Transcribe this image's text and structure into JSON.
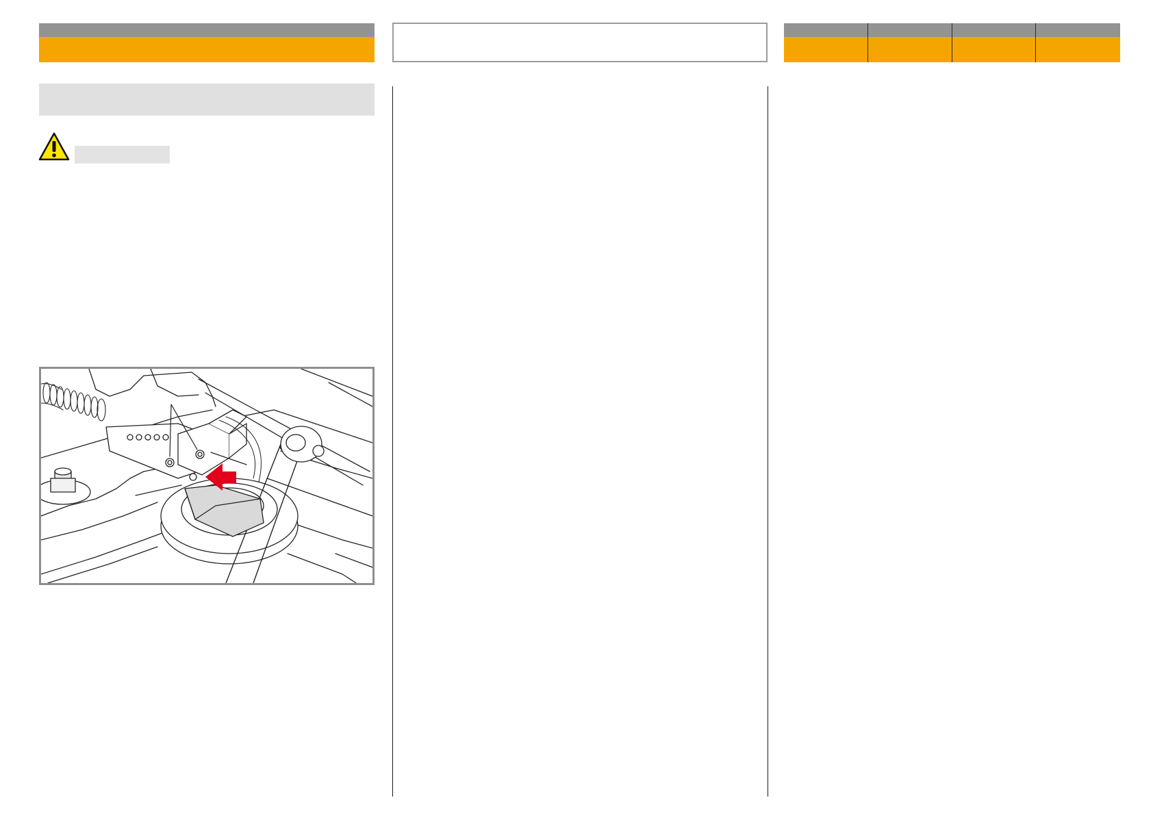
{
  "colors": {
    "accent": "#f5a500",
    "header_grey": "#939393",
    "section_grey": "#e0e0e0",
    "warning_yellow": "#ffe600",
    "highlight_red": "#e3001b",
    "part_grey": "#d9d9d9"
  },
  "left_header": {},
  "title_box": {},
  "right_tabs": {
    "count": 4
  },
  "section": {},
  "warning": {
    "icon": "warning-triangle-icon"
  },
  "figure": {
    "subject": "tensioner-arm-belt-guide-illustration"
  }
}
